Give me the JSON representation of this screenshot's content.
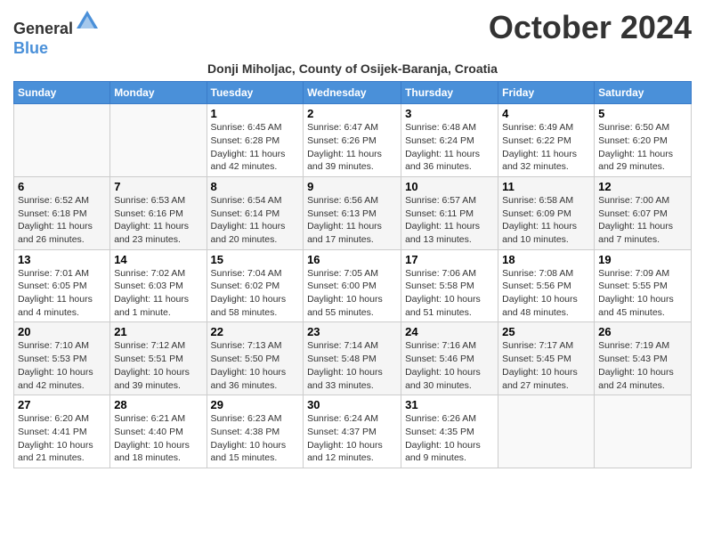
{
  "header": {
    "logo_line1": "General",
    "logo_line2": "Blue",
    "month_title": "October 2024",
    "subtitle": "Donji Miholjac, County of Osijek-Baranja, Croatia"
  },
  "days_of_week": [
    "Sunday",
    "Monday",
    "Tuesday",
    "Wednesday",
    "Thursday",
    "Friday",
    "Saturday"
  ],
  "weeks": [
    [
      {
        "day": "",
        "sunrise": "",
        "sunset": "",
        "daylight": ""
      },
      {
        "day": "",
        "sunrise": "",
        "sunset": "",
        "daylight": ""
      },
      {
        "day": "1",
        "sunrise": "Sunrise: 6:45 AM",
        "sunset": "Sunset: 6:28 PM",
        "daylight": "Daylight: 11 hours and 42 minutes."
      },
      {
        "day": "2",
        "sunrise": "Sunrise: 6:47 AM",
        "sunset": "Sunset: 6:26 PM",
        "daylight": "Daylight: 11 hours and 39 minutes."
      },
      {
        "day": "3",
        "sunrise": "Sunrise: 6:48 AM",
        "sunset": "Sunset: 6:24 PM",
        "daylight": "Daylight: 11 hours and 36 minutes."
      },
      {
        "day": "4",
        "sunrise": "Sunrise: 6:49 AM",
        "sunset": "Sunset: 6:22 PM",
        "daylight": "Daylight: 11 hours and 32 minutes."
      },
      {
        "day": "5",
        "sunrise": "Sunrise: 6:50 AM",
        "sunset": "Sunset: 6:20 PM",
        "daylight": "Daylight: 11 hours and 29 minutes."
      }
    ],
    [
      {
        "day": "6",
        "sunrise": "Sunrise: 6:52 AM",
        "sunset": "Sunset: 6:18 PM",
        "daylight": "Daylight: 11 hours and 26 minutes."
      },
      {
        "day": "7",
        "sunrise": "Sunrise: 6:53 AM",
        "sunset": "Sunset: 6:16 PM",
        "daylight": "Daylight: 11 hours and 23 minutes."
      },
      {
        "day": "8",
        "sunrise": "Sunrise: 6:54 AM",
        "sunset": "Sunset: 6:14 PM",
        "daylight": "Daylight: 11 hours and 20 minutes."
      },
      {
        "day": "9",
        "sunrise": "Sunrise: 6:56 AM",
        "sunset": "Sunset: 6:13 PM",
        "daylight": "Daylight: 11 hours and 17 minutes."
      },
      {
        "day": "10",
        "sunrise": "Sunrise: 6:57 AM",
        "sunset": "Sunset: 6:11 PM",
        "daylight": "Daylight: 11 hours and 13 minutes."
      },
      {
        "day": "11",
        "sunrise": "Sunrise: 6:58 AM",
        "sunset": "Sunset: 6:09 PM",
        "daylight": "Daylight: 11 hours and 10 minutes."
      },
      {
        "day": "12",
        "sunrise": "Sunrise: 7:00 AM",
        "sunset": "Sunset: 6:07 PM",
        "daylight": "Daylight: 11 hours and 7 minutes."
      }
    ],
    [
      {
        "day": "13",
        "sunrise": "Sunrise: 7:01 AM",
        "sunset": "Sunset: 6:05 PM",
        "daylight": "Daylight: 11 hours and 4 minutes."
      },
      {
        "day": "14",
        "sunrise": "Sunrise: 7:02 AM",
        "sunset": "Sunset: 6:03 PM",
        "daylight": "Daylight: 11 hours and 1 minute."
      },
      {
        "day": "15",
        "sunrise": "Sunrise: 7:04 AM",
        "sunset": "Sunset: 6:02 PM",
        "daylight": "Daylight: 10 hours and 58 minutes."
      },
      {
        "day": "16",
        "sunrise": "Sunrise: 7:05 AM",
        "sunset": "Sunset: 6:00 PM",
        "daylight": "Daylight: 10 hours and 55 minutes."
      },
      {
        "day": "17",
        "sunrise": "Sunrise: 7:06 AM",
        "sunset": "Sunset: 5:58 PM",
        "daylight": "Daylight: 10 hours and 51 minutes."
      },
      {
        "day": "18",
        "sunrise": "Sunrise: 7:08 AM",
        "sunset": "Sunset: 5:56 PM",
        "daylight": "Daylight: 10 hours and 48 minutes."
      },
      {
        "day": "19",
        "sunrise": "Sunrise: 7:09 AM",
        "sunset": "Sunset: 5:55 PM",
        "daylight": "Daylight: 10 hours and 45 minutes."
      }
    ],
    [
      {
        "day": "20",
        "sunrise": "Sunrise: 7:10 AM",
        "sunset": "Sunset: 5:53 PM",
        "daylight": "Daylight: 10 hours and 42 minutes."
      },
      {
        "day": "21",
        "sunrise": "Sunrise: 7:12 AM",
        "sunset": "Sunset: 5:51 PM",
        "daylight": "Daylight: 10 hours and 39 minutes."
      },
      {
        "day": "22",
        "sunrise": "Sunrise: 7:13 AM",
        "sunset": "Sunset: 5:50 PM",
        "daylight": "Daylight: 10 hours and 36 minutes."
      },
      {
        "day": "23",
        "sunrise": "Sunrise: 7:14 AM",
        "sunset": "Sunset: 5:48 PM",
        "daylight": "Daylight: 10 hours and 33 minutes."
      },
      {
        "day": "24",
        "sunrise": "Sunrise: 7:16 AM",
        "sunset": "Sunset: 5:46 PM",
        "daylight": "Daylight: 10 hours and 30 minutes."
      },
      {
        "day": "25",
        "sunrise": "Sunrise: 7:17 AM",
        "sunset": "Sunset: 5:45 PM",
        "daylight": "Daylight: 10 hours and 27 minutes."
      },
      {
        "day": "26",
        "sunrise": "Sunrise: 7:19 AM",
        "sunset": "Sunset: 5:43 PM",
        "daylight": "Daylight: 10 hours and 24 minutes."
      }
    ],
    [
      {
        "day": "27",
        "sunrise": "Sunrise: 6:20 AM",
        "sunset": "Sunset: 4:41 PM",
        "daylight": "Daylight: 10 hours and 21 minutes."
      },
      {
        "day": "28",
        "sunrise": "Sunrise: 6:21 AM",
        "sunset": "Sunset: 4:40 PM",
        "daylight": "Daylight: 10 hours and 18 minutes."
      },
      {
        "day": "29",
        "sunrise": "Sunrise: 6:23 AM",
        "sunset": "Sunset: 4:38 PM",
        "daylight": "Daylight: 10 hours and 15 minutes."
      },
      {
        "day": "30",
        "sunrise": "Sunrise: 6:24 AM",
        "sunset": "Sunset: 4:37 PM",
        "daylight": "Daylight: 10 hours and 12 minutes."
      },
      {
        "day": "31",
        "sunrise": "Sunrise: 6:26 AM",
        "sunset": "Sunset: 4:35 PM",
        "daylight": "Daylight: 10 hours and 9 minutes."
      },
      {
        "day": "",
        "sunrise": "",
        "sunset": "",
        "daylight": ""
      },
      {
        "day": "",
        "sunrise": "",
        "sunset": "",
        "daylight": ""
      }
    ]
  ]
}
